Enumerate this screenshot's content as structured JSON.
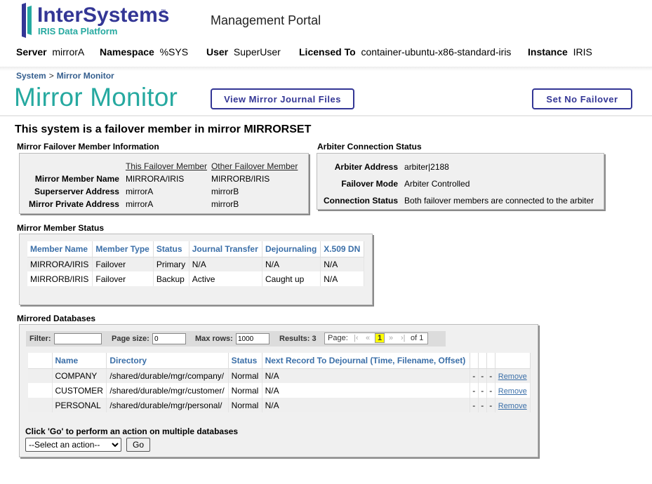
{
  "header": {
    "logo_text": "InterSystems",
    "logo_tm": "™",
    "logo_sub": "IRIS Data Platform",
    "portal_title": "Management Portal",
    "server_bar": [
      {
        "label": "Server",
        "value": "mirrorA"
      },
      {
        "label": "Namespace",
        "value": "%SYS"
      },
      {
        "label": "User",
        "value": "SuperUser"
      },
      {
        "label": "Licensed To",
        "value": "container-ubuntu-x86-standard-iris"
      },
      {
        "label": "Instance",
        "value": "IRIS"
      }
    ]
  },
  "breadcrumb": {
    "root": "System",
    "sep": ">",
    "current": "Mirror Monitor"
  },
  "page_title": "Mirror Monitor",
  "buttons": {
    "view_journal": "View Mirror Journal Files",
    "set_no_failover": "Set No Failover"
  },
  "mirror_heading": "This system is a failover member in mirror MIRRORSET",
  "failover_info": {
    "title": "Mirror Failover Member Information",
    "col_this": "This Failover Member",
    "col_other": "Other Failover Member",
    "rows": [
      {
        "label": "Mirror Member Name",
        "this": "MIRRORA/IRIS",
        "other": "MIRRORB/IRIS"
      },
      {
        "label": "Superserver Address",
        "this": "mirrorA",
        "other": "mirrorB"
      },
      {
        "label": "Mirror Private Address",
        "this": "mirrorA",
        "other": "mirrorB"
      }
    ]
  },
  "arbiter": {
    "title": "Arbiter Connection Status",
    "rows": [
      {
        "label": "Arbiter Address",
        "value": "arbiter|2188"
      },
      {
        "label": "Failover Mode",
        "value": "Arbiter Controlled"
      },
      {
        "label": "Connection Status",
        "value": "Both failover members are connected to the arbiter"
      }
    ]
  },
  "member_status": {
    "title": "Mirror Member Status",
    "columns": [
      "Member Name",
      "Member Type",
      "Status",
      "Journal Transfer",
      "Dejournaling",
      "X.509 DN"
    ],
    "rows": [
      [
        "MIRRORA/IRIS",
        "Failover",
        "Primary",
        "N/A",
        "N/A",
        "N/A"
      ],
      [
        "MIRRORB/IRIS",
        "Failover",
        "Backup",
        "Active",
        "Caught up",
        "N/A"
      ]
    ]
  },
  "databases": {
    "title": "Mirrored Databases",
    "filter": {
      "filter_label": "Filter:",
      "filter_value": "",
      "page_size_label": "Page size:",
      "page_size_value": "0",
      "max_rows_label": "Max rows:",
      "max_rows_value": "1000",
      "results_label": "Results: 3",
      "page_label": "Page:",
      "nav_first": "|‹",
      "nav_prev": "«",
      "page_current": "1",
      "nav_next": "»",
      "nav_last": "›|",
      "page_of": "of 1"
    },
    "columns": [
      "Name",
      "Directory",
      "Status",
      "Next Record To Dejournal (Time, Filename, Offset)"
    ],
    "rows": [
      {
        "name": "COMPANY",
        "dir": "/shared/durable/mgr/company/",
        "status": "Normal",
        "next": "N/A",
        "d1": "-",
        "d2": "-",
        "d3": "-",
        "action": "Remove"
      },
      {
        "name": "CUSTOMER",
        "dir": "/shared/durable/mgr/customer/",
        "status": "Normal",
        "next": "N/A",
        "d1": "-",
        "d2": "-",
        "d3": "-",
        "action": "Remove"
      },
      {
        "name": "PERSONAL",
        "dir": "/shared/durable/mgr/personal/",
        "status": "Normal",
        "next": "N/A",
        "d1": "-",
        "d2": "-",
        "d3": "-",
        "action": "Remove"
      }
    ],
    "action_label": "Click 'Go' to perform an action on multiple databases",
    "action_select": "--Select an action--",
    "go_label": "Go"
  },
  "colors": {
    "teal": "#26a9a0",
    "navy": "#333695",
    "link": "#3b6fa8",
    "highlight": "#ffff00"
  }
}
